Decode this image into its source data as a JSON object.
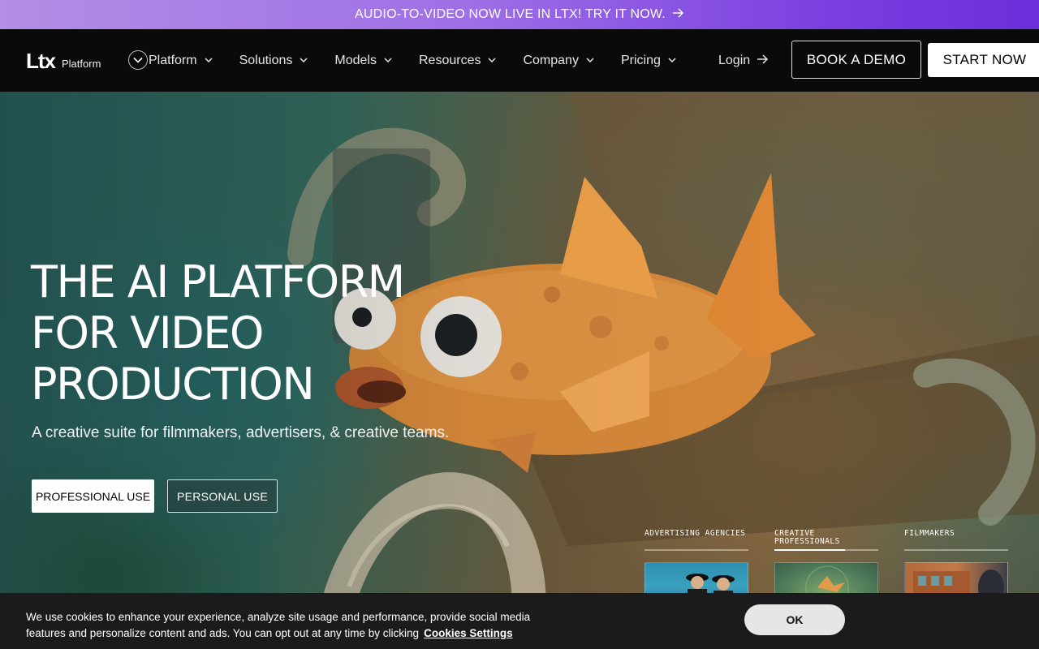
{
  "announcement": {
    "text": "AUDIO-TO-VIDEO NOW LIVE IN LTX! TRY IT NOW.",
    "icon": "arrow-right-icon"
  },
  "nav": {
    "logo": "Ltx",
    "logo_sub": "Platform",
    "items": [
      {
        "label": "Platform"
      },
      {
        "label": "Solutions"
      },
      {
        "label": "Models"
      },
      {
        "label": "Resources"
      },
      {
        "label": "Company"
      },
      {
        "label": "Pricing"
      }
    ],
    "login": "Login",
    "book_demo": "BOOK A DEMO",
    "start_now": "START NOW"
  },
  "hero": {
    "headline": "THE AI PLATFORM\nFOR VIDEO\nPRODUCTION",
    "subhead": "A creative suite for filmmakers, advertisers, & creative teams.",
    "btn_professional": "PROFESSIONAL USE",
    "btn_personal": "PERSONAL USE",
    "categories": [
      {
        "label": "ADVERTISING AGENCIES",
        "active": false
      },
      {
        "label": "CREATIVE\nPROFESSIONALS",
        "active": true,
        "progress": 0.68
      },
      {
        "label": "FILMMAKERS",
        "active": false
      }
    ]
  },
  "cookie": {
    "text": "We use cookies to enhance your experience, analyze site usage and performance, provide social media features and personalize content and ads. You can opt out at any time by clicking",
    "link": "Cookies Settings",
    "ok": "OK"
  },
  "colors": {
    "accent_start": "#b28ee6",
    "accent_end": "#6a2fd9",
    "nav_bg": "#0a0a0a",
    "cookie_bg": "#1b1b1d"
  }
}
